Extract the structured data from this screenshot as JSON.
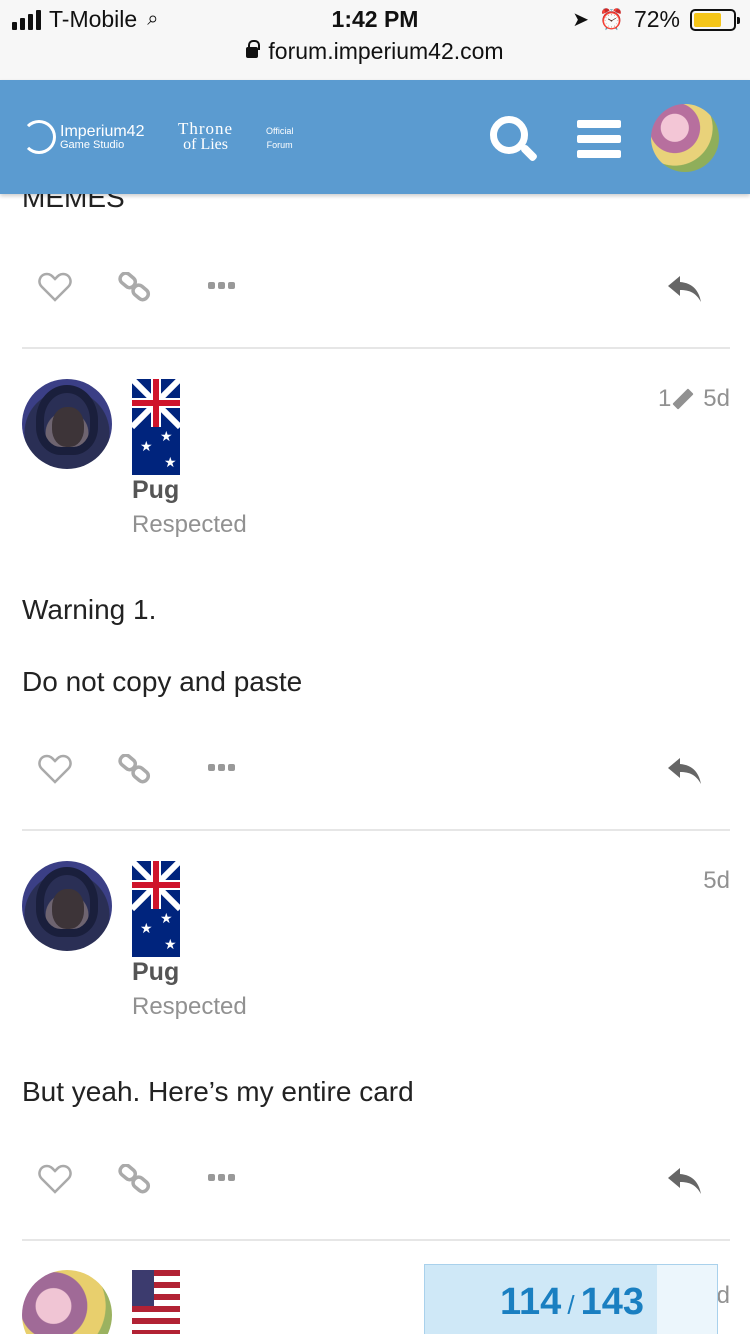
{
  "status_bar": {
    "carrier": "T-Mobile",
    "time": "1:42 PM",
    "battery": "72%",
    "battery_level": 0.72,
    "url": "forum.imperium42.com"
  },
  "header": {
    "logo_main": "Imperium42",
    "logo_sub": "Game Studio",
    "game_top": "Throne",
    "game_bottom": "of Lies",
    "official_line1": "Official",
    "official_line2": "Forum"
  },
  "previous_post": {
    "text": "MEMES"
  },
  "posts": [
    {
      "username": "Pug",
      "title": "Respected",
      "edit_count": "1",
      "age": "5d",
      "lines": [
        "Warning 1.",
        "Do not copy and paste"
      ]
    },
    {
      "username": "Pug",
      "title": "Respected",
      "age": "5d",
      "lines": [
        "But yeah. Here’s my entire card"
      ]
    }
  ],
  "progress": {
    "current": "114",
    "separator": "/",
    "total": "143",
    "fraction": 0.797
  },
  "stray_meta": "d"
}
